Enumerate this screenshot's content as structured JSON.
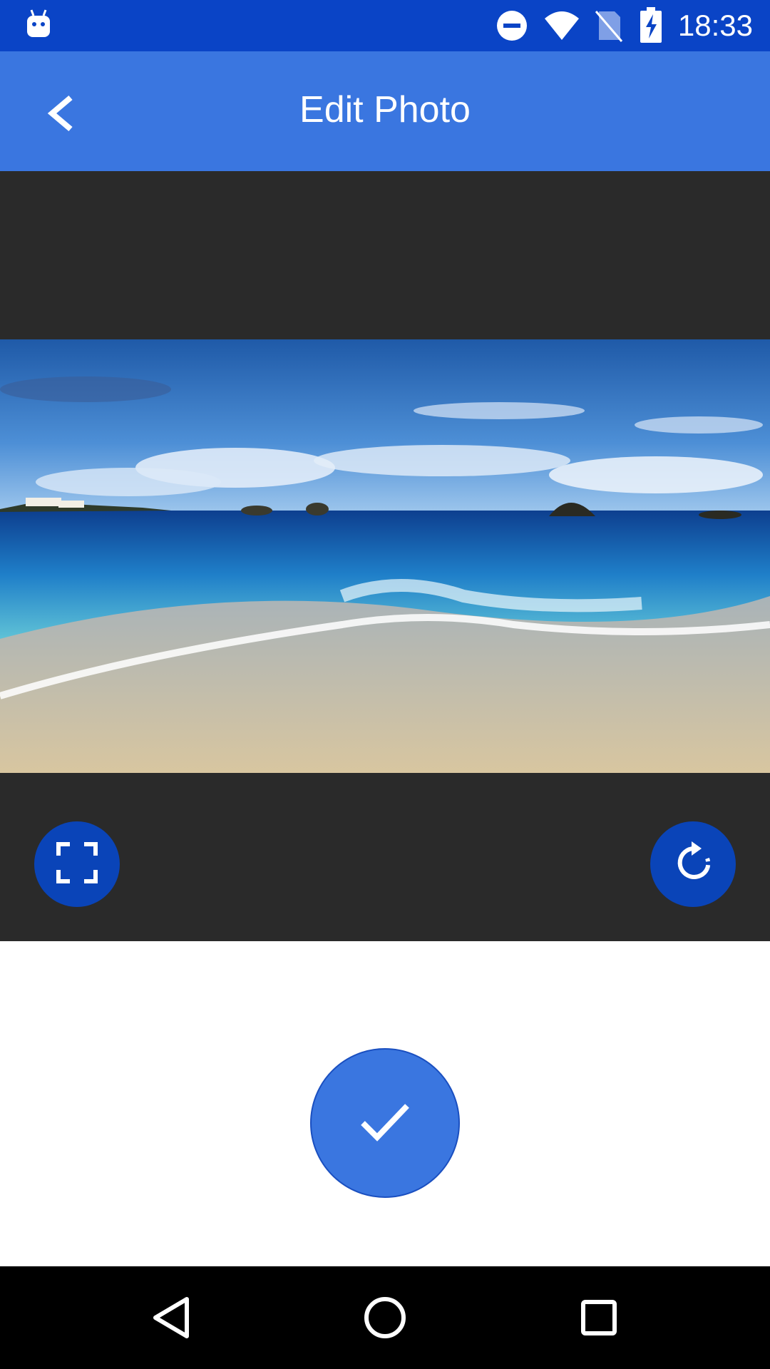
{
  "status_bar": {
    "time": "18:33",
    "icons": [
      "android-notification-icon",
      "do-not-disturb-icon",
      "wifi-icon",
      "no-sim-icon",
      "battery-charging-icon"
    ],
    "background_color": "#0a44c6"
  },
  "app_bar": {
    "title": "Edit Photo",
    "back_icon": "chevron-left-icon",
    "background_color": "#3a76e0"
  },
  "editor": {
    "background_color": "#2a2a2a",
    "crop_button_icon": "crop-free-icon",
    "rotate_button_icon": "rotate-icon"
  },
  "confirm": {
    "icon": "check-icon",
    "color": "#3a76e0"
  },
  "nav_bar": {
    "items": [
      "back-triangle-icon",
      "home-circle-icon",
      "recents-square-icon"
    ]
  }
}
